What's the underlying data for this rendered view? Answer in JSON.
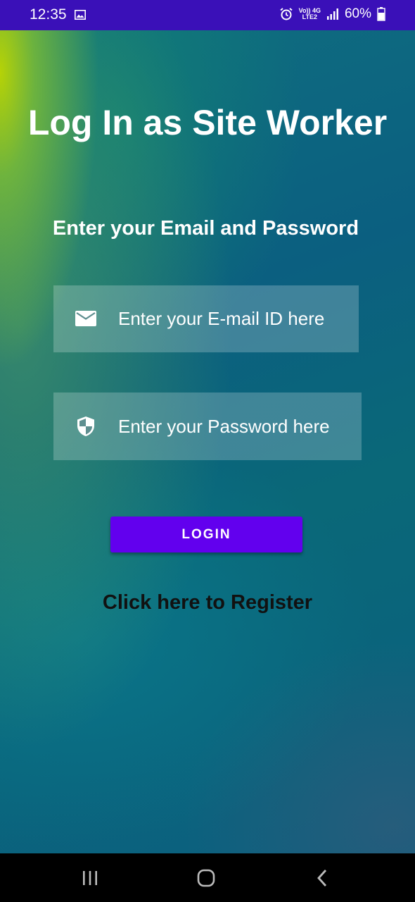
{
  "status_bar": {
    "time": "12:35",
    "network_top": "Vo)) 4G",
    "network_bottom": "LTE2",
    "battery": "60%"
  },
  "login": {
    "title": "Log In as Site Worker",
    "subtitle": "Enter your Email and Password",
    "email": {
      "placeholder": "Enter your E-mail ID here",
      "value": "",
      "icon": "mail-icon"
    },
    "password": {
      "placeholder": "Enter your Password here",
      "value": "",
      "icon": "shield-icon"
    },
    "login_button": "LOGIN",
    "register_link": "Click here to Register"
  },
  "colors": {
    "status_bar": "#3a10b8",
    "button": "#6200ee"
  }
}
